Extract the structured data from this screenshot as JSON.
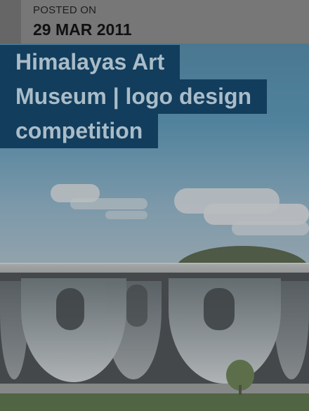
{
  "post": {
    "posted_label": "POSTED ON",
    "date": "29 MAR 2011",
    "title_lines": [
      "Himalayas Art",
      "Museum | logo design",
      "competition"
    ]
  },
  "colors": {
    "title_background": "#123d5c",
    "title_text": "#a9bcc8",
    "meta_background": "#777777"
  }
}
